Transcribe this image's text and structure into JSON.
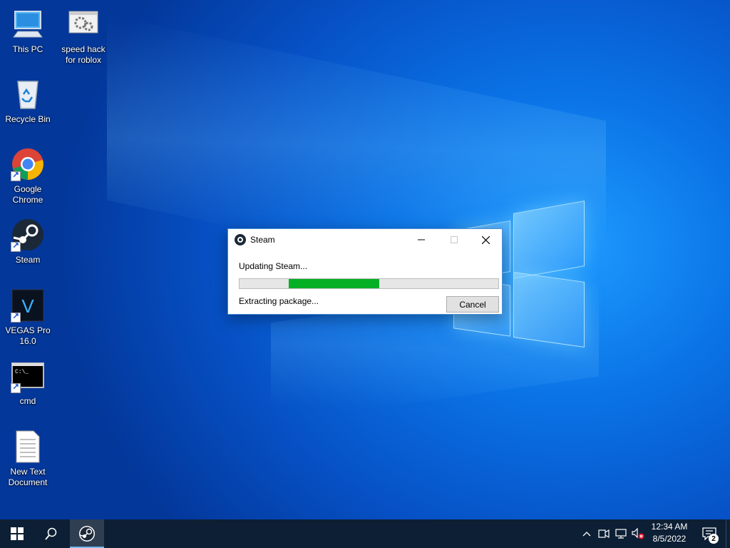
{
  "desktop": {
    "icons": [
      {
        "label": "This PC",
        "icon": "computer-icon"
      },
      {
        "label": "speed hack for roblox",
        "icon": "settings-app-icon"
      },
      {
        "label": "Recycle Bin",
        "icon": "recycle-bin-icon"
      },
      {
        "label": "Google Chrome",
        "icon": "chrome-icon"
      },
      {
        "label": "Steam",
        "icon": "steam-icon"
      },
      {
        "label": "VEGAS Pro 16.0",
        "icon": "vegas-icon"
      },
      {
        "label": "cmd",
        "icon": "cmd-icon"
      },
      {
        "label": "New Text Document",
        "icon": "text-document-icon"
      }
    ]
  },
  "dialog": {
    "title": "Steam",
    "status_line": "Updating Steam...",
    "progress": {
      "start": 0.19,
      "end": 0.54,
      "color": "#06b025"
    },
    "detail_line": "Extracting package...",
    "cancel_label": "Cancel"
  },
  "taskbar": {
    "time": "12:34 AM",
    "date": "8/5/2022",
    "notification_count": "2",
    "accent": "#0d1f35"
  }
}
